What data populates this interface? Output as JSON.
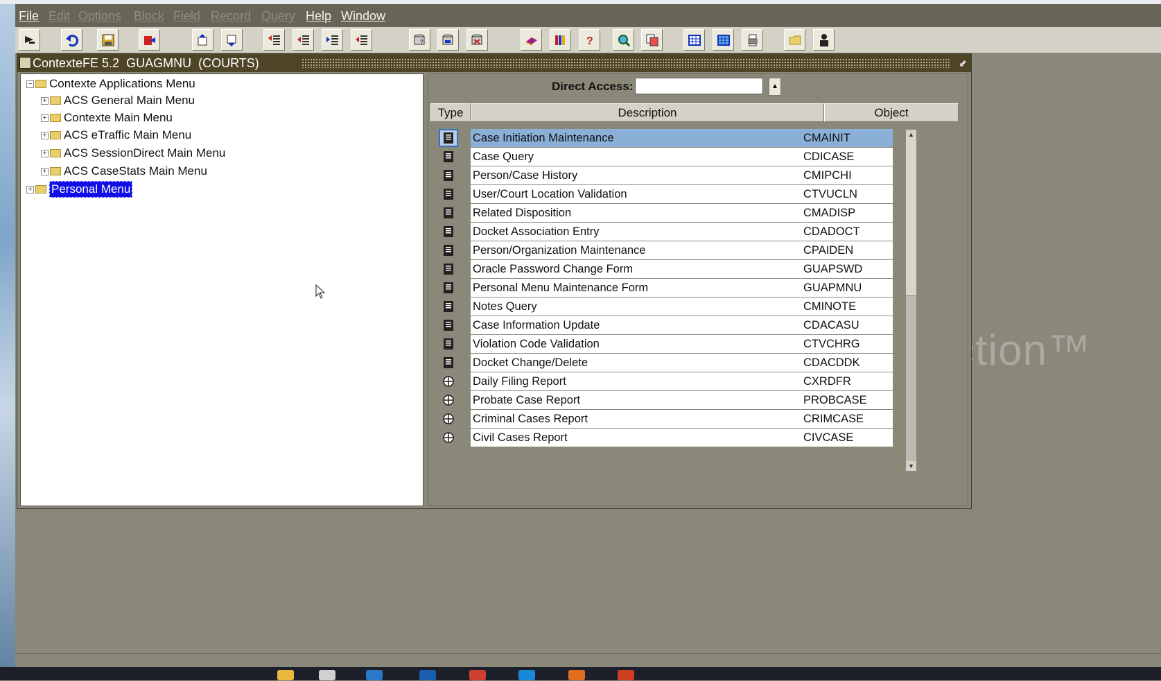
{
  "menubar": {
    "items": [
      {
        "label": "File",
        "enabled": true
      },
      {
        "label": "Edit",
        "enabled": false
      },
      {
        "label": "Options",
        "enabled": false
      },
      {
        "label": "Block",
        "enabled": false
      },
      {
        "label": "Field",
        "enabled": false
      },
      {
        "label": "Record",
        "enabled": false
      },
      {
        "label": "Query",
        "enabled": false
      },
      {
        "label": "Help",
        "enabled": true
      },
      {
        "label": "Window",
        "enabled": true
      }
    ]
  },
  "toolbar": {
    "icons": [
      "exit-icon",
      "rollback-icon",
      "save-icon",
      "print-icon",
      "previous-block-icon",
      "next-block-icon",
      "previous-record-icon",
      "next-record-icon",
      "insert-record-icon",
      "delete-record-icon",
      "enter-query-icon",
      "execute-query-icon",
      "cancel-query-icon",
      "book-icon",
      "library-icon",
      "help-icon",
      "search-icon",
      "copy-icon",
      "grid-icon",
      "calculator-icon",
      "printer-icon",
      "folder-icon",
      "user-icon"
    ]
  },
  "window": {
    "title": "ContexteFE 5.2  GUAGMNU  (COURTS)"
  },
  "tree": {
    "root": "Contexte Applications Menu",
    "children": [
      "ACS General Main Menu",
      "Contexte Main Menu",
      "ACS eTraffic Main Menu",
      "ACS SessionDirect Main Menu",
      "ACS CaseStats Main Menu"
    ],
    "personal": "Personal Menu"
  },
  "direct_access": {
    "label": "Direct Access:",
    "value": ""
  },
  "table": {
    "headers": {
      "type": "Type",
      "description": "Description",
      "object": "Object"
    },
    "rows": [
      {
        "type": "form",
        "description": "Case Initiation Maintenance",
        "object": "CMAINIT",
        "selected": true
      },
      {
        "type": "form",
        "description": "Case Query",
        "object": "CDICASE"
      },
      {
        "type": "form",
        "description": "Person/Case History",
        "object": "CMIPCHI"
      },
      {
        "type": "form",
        "description": "User/Court Location Validation",
        "object": "CTVUCLN"
      },
      {
        "type": "form",
        "description": "Related Disposition",
        "object": "CMADISP"
      },
      {
        "type": "form",
        "description": "Docket Association Entry",
        "object": "CDADOCT"
      },
      {
        "type": "form",
        "description": "Person/Organization Maintenance",
        "object": "CPAIDEN"
      },
      {
        "type": "form",
        "description": "Oracle Password Change Form",
        "object": "GUAPSWD"
      },
      {
        "type": "form",
        "description": "Personal Menu Maintenance Form",
        "object": "GUAPMNU"
      },
      {
        "type": "form",
        "description": "Notes Query",
        "object": "CMINOTE"
      },
      {
        "type": "form",
        "description": "Case Information Update",
        "object": "CDACASU"
      },
      {
        "type": "form",
        "description": "Violation Code Validation",
        "object": "CTVCHRG"
      },
      {
        "type": "form",
        "description": "Docket Change/Delete",
        "object": "CDACDDK"
      },
      {
        "type": "report",
        "description": "Daily Filing Report",
        "object": "CXRDFR"
      },
      {
        "type": "report",
        "description": "Probate Case Report",
        "object": "PROBCASE"
      },
      {
        "type": "report",
        "description": "Criminal Cases Report",
        "object": "CRIMCASE"
      },
      {
        "type": "report",
        "description": "Civil Cases Report",
        "object": "CIVCASE"
      }
    ]
  },
  "watermark": "ction™",
  "colors": {
    "menubar": "#686556",
    "titlebar": "#4e4426",
    "selection": "#8bb0d8",
    "tree_selection": "#1010e6"
  }
}
